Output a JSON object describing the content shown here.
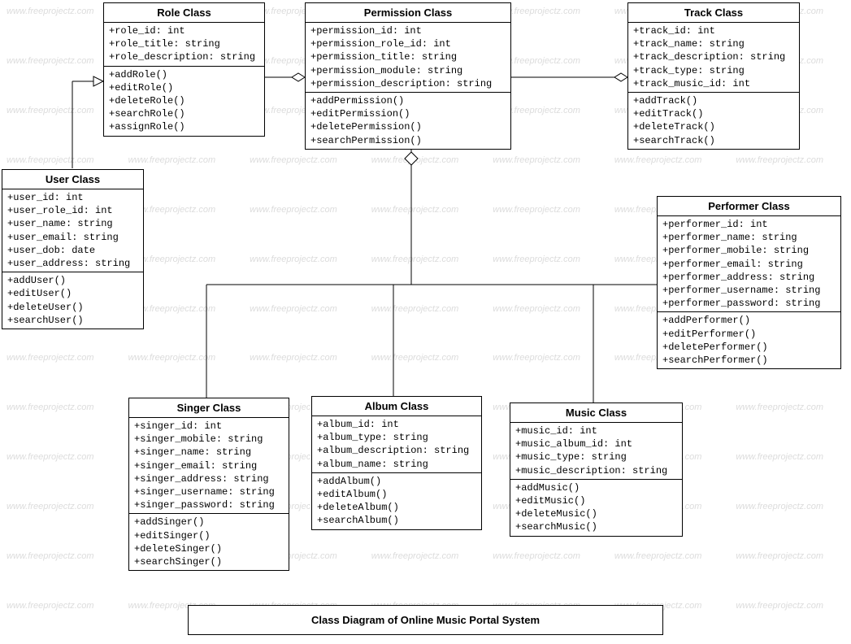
{
  "watermark_text": "www.freeprojectz.com",
  "diagram_title": "Class Diagram of Online Music Portal System",
  "classes": {
    "role": {
      "name": "Role Class",
      "attrs": [
        "+role_id: int",
        "+role_title: string",
        "+role_description: string"
      ],
      "methods": [
        "+addRole()",
        "+editRole()",
        "+deleteRole()",
        "+searchRole()",
        "+assignRole()"
      ]
    },
    "permission": {
      "name": "Permission Class",
      "attrs": [
        "+permission_id: int",
        "+permission_role_id: int",
        "+permission_title: string",
        "+permission_module: string",
        "+permission_description: string"
      ],
      "methods": [
        "+addPermission()",
        "+editPermission()",
        "+deletePermission()",
        "+searchPermission()"
      ]
    },
    "track": {
      "name": "Track Class",
      "attrs": [
        "+track_id: int",
        "+track_name: string",
        "+track_description: string",
        "+track_type: string",
        "+track_music_id: int"
      ],
      "methods": [
        "+addTrack()",
        "+editTrack()",
        "+deleteTrack()",
        "+searchTrack()"
      ]
    },
    "user": {
      "name": "User Class",
      "attrs": [
        "+user_id: int",
        "+user_role_id: int",
        "+user_name: string",
        "+user_email: string",
        "+user_dob: date",
        "+user_address: string"
      ],
      "methods": [
        "+addUser()",
        "+editUser()",
        "+deleteUser()",
        "+searchUser()"
      ]
    },
    "performer": {
      "name": "Performer Class",
      "attrs": [
        "+performer_id: int",
        "+performer_name: string",
        "+performer_mobile: string",
        "+performer_email: string",
        "+performer_address: string",
        "+performer_username: string",
        "+performer_password: string"
      ],
      "methods": [
        "+addPerformer()",
        "+editPerformer()",
        "+deletePerformer()",
        "+searchPerformer()"
      ]
    },
    "singer": {
      "name": "Singer Class",
      "attrs": [
        "+singer_id: int",
        "+singer_mobile: string",
        "+singer_name: string",
        "+singer_email: string",
        "+singer_address: string",
        "+singer_username: string",
        "+singer_password: string"
      ],
      "methods": [
        "+addSinger()",
        "+editSinger()",
        "+deleteSinger()",
        "+searchSinger()"
      ]
    },
    "album": {
      "name": "Album Class",
      "attrs": [
        "+album_id: int",
        "+album_type: string",
        "+album_description: string",
        "+album_name: string"
      ],
      "methods": [
        "+addAlbum()",
        "+editAlbum()",
        "+deleteAlbum()",
        "+searchAlbum()"
      ]
    },
    "music": {
      "name": "Music Class",
      "attrs": [
        "+music_id: int",
        "+music_album_id: int",
        "+music_type: string",
        "+music_description: string"
      ],
      "methods": [
        "+addMusic()",
        "+editMusic()",
        "+deleteMusic()",
        "+searchMusic()"
      ]
    }
  }
}
